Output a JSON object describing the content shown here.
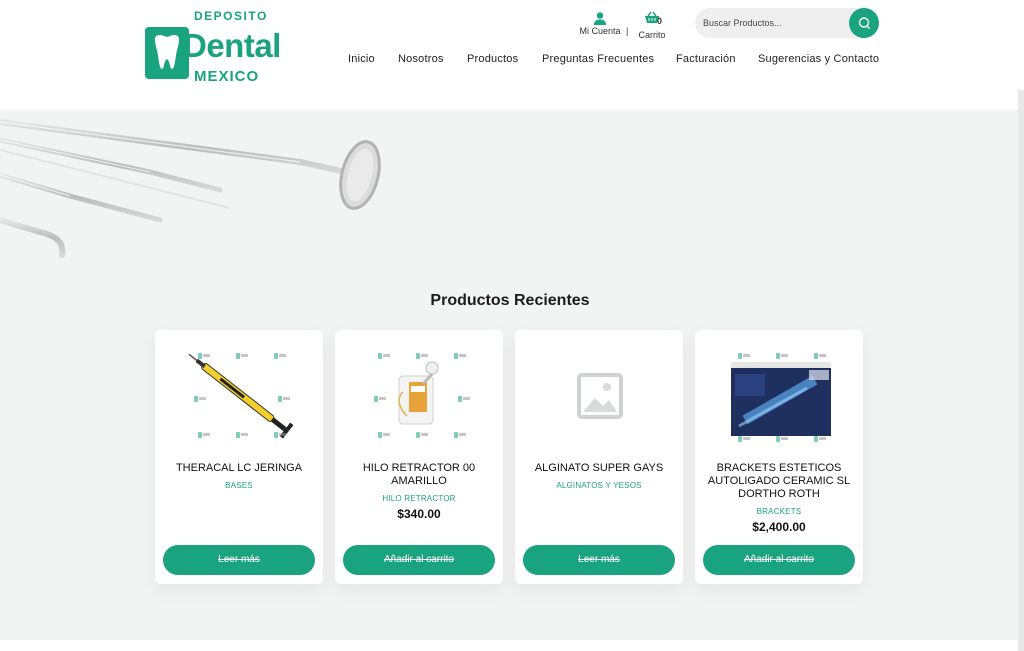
{
  "logo": {
    "top": "DEPOSITO",
    "main": "Dental",
    "bottom": "MEXICO"
  },
  "header": {
    "account_label": "Mi Cuenta",
    "separator": "|",
    "cart_label": "Carrito",
    "cart_count": "0",
    "search_placeholder": "Buscar Productos..."
  },
  "nav": {
    "items": [
      {
        "label": "Inicio"
      },
      {
        "label": "Nosotros"
      },
      {
        "label": "Productos"
      },
      {
        "label": "Preguntas Frecuentes"
      },
      {
        "label": "Facturación"
      },
      {
        "label": "Sugerencias y Contacto"
      }
    ]
  },
  "section": {
    "title": "Productos Recientes"
  },
  "products": [
    {
      "title": "THERACAL LC JERINGA",
      "category": "BASES",
      "price": "",
      "button": "Leer más",
      "image": "syringe-image"
    },
    {
      "title": "HILO RETRACTOR 00 AMARILLO",
      "category": "HILO RETRACTOR",
      "price": "$340.00",
      "button": "Añadir al carrito",
      "image": "retraction-cord-image"
    },
    {
      "title": "ALGINATO SUPER GAYS",
      "category": "ALGINATOS Y YESOS",
      "price": "",
      "button": "Leer más",
      "image": "placeholder-image-icon"
    },
    {
      "title": "BRACKETS ESTETICOS AUTOLIGADO CERAMIC SL DORTHO ROTH",
      "category": "BRACKETS",
      "price": "$2,400.00",
      "button": "Añadir al carrito",
      "image": "brackets-box-image"
    }
  ],
  "colors": {
    "accent": "#1aa37f",
    "background": "#f2f3f3"
  }
}
